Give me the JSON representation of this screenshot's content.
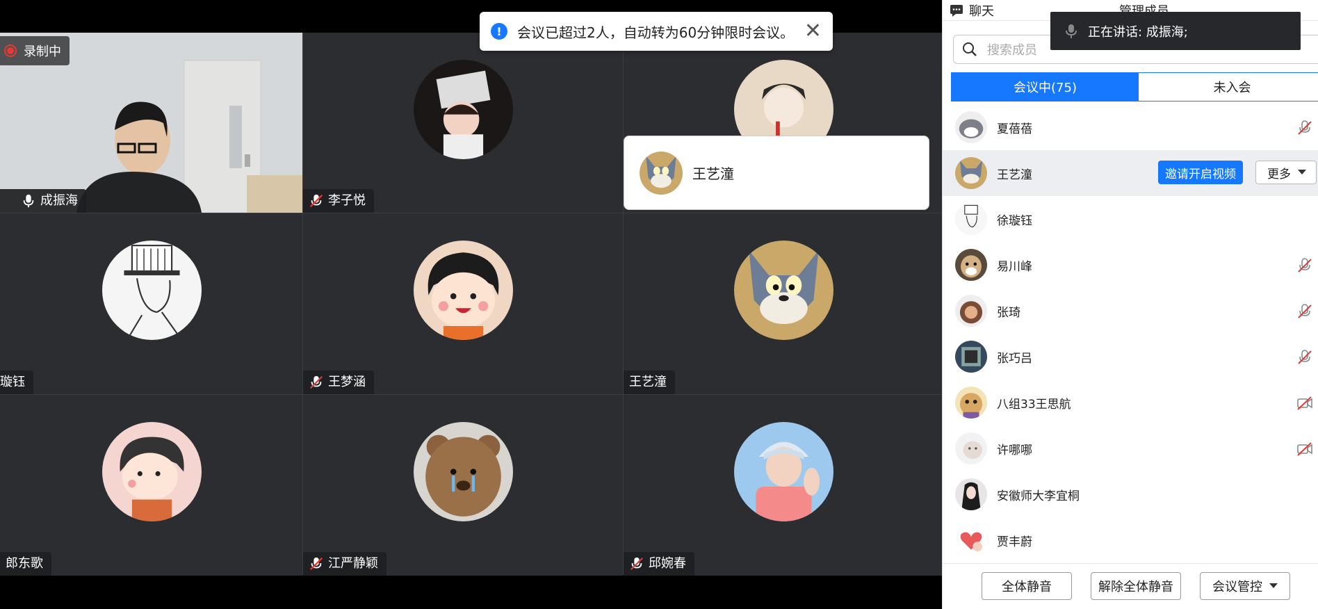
{
  "toast": {
    "message": "会议已超过2人，自动转为60分钟限时会议。",
    "close_icon": "close-icon"
  },
  "recording": {
    "label": "录制中"
  },
  "tiles": [
    {
      "name": "成振海",
      "muted": false,
      "active": true,
      "video": true
    },
    {
      "name": "李子悦",
      "muted": true
    },
    {
      "name": "",
      "muted": false
    },
    {
      "name": "璇钰",
      "muted": false
    },
    {
      "name": "王梦涵",
      "muted": true
    },
    {
      "name": "王艺潼",
      "muted": false
    },
    {
      "name": "郎东歌",
      "muted": false
    },
    {
      "name": "江严静颖",
      "muted": true
    },
    {
      "name": "邱婉春",
      "muted": true
    }
  ],
  "hover_popup": {
    "name": "王艺潼"
  },
  "panel": {
    "tab_chat": "聊天",
    "tab_manage": "管理成员",
    "speaking": "正在讲话:  成振海;",
    "search_placeholder": "搜索成员",
    "tab_in_meeting": "会议中(75)",
    "tab_not_joined": "未入会",
    "invite_video": "邀请开启视频",
    "more": "更多",
    "members": [
      {
        "name": "夏蓓蓓",
        "status": "mic-muted"
      },
      {
        "name": "王艺潼",
        "status": "hover"
      },
      {
        "name": "徐璇钰",
        "status": ""
      },
      {
        "name": "易川峰",
        "status": "mic-muted"
      },
      {
        "name": "张琦",
        "status": "mic-muted"
      },
      {
        "name": "张巧吕",
        "status": "mic-muted"
      },
      {
        "name": "八组33王思航",
        "status": "video-off"
      },
      {
        "name": "许哪哪",
        "status": "video-off"
      },
      {
        "name": "安徽师大李宜桐",
        "status": ""
      },
      {
        "name": "贾丰蔚",
        "status": ""
      }
    ],
    "btn_mute_all": "全体静音",
    "btn_unmute_all": "解除全体静音",
    "btn_control": "会议管控"
  }
}
